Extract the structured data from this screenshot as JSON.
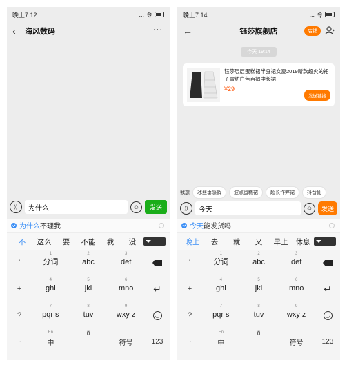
{
  "left": {
    "status": {
      "time": "晚上7:12",
      "signal": "...",
      "wifi": "令"
    },
    "header": {
      "title": "海风数码",
      "more": "···"
    },
    "input": {
      "text": "为什么",
      "send": "发送"
    },
    "prediction": {
      "highlight": "为什么",
      "rest": "不理我"
    },
    "candidates": [
      "不",
      "这么",
      "要",
      "不能",
      "我",
      "没"
    ],
    "keyboard": {
      "left_col": [
        "'",
        "+",
        "?",
        "!"
      ],
      "keys": [
        {
          "num": "1",
          "label": "分词"
        },
        {
          "num": "2",
          "label": "abc"
        },
        {
          "num": "3",
          "label": "def"
        },
        {
          "num": "4",
          "label": "ghi"
        },
        {
          "num": "5",
          "label": "jkl"
        },
        {
          "num": "6",
          "label": "mno"
        },
        {
          "num": "7",
          "label": "pqr s"
        },
        {
          "num": "8",
          "label": "tuv"
        },
        {
          "num": "9",
          "label": "wxy z"
        }
      ],
      "bottom": {
        "tilde": "~",
        "lang_small": "En",
        "lang": "中",
        "space_num": "0",
        "symbols": "符号",
        "num_mode": "123"
      }
    }
  },
  "right": {
    "status": {
      "time": "晚上7:14",
      "signal": "...",
      "wifi": "令"
    },
    "header": {
      "title": "钰莎旗舰店",
      "follow": "店铺"
    },
    "timestamp": "今天 19:14",
    "product": {
      "title": "钰莎层层蛋糕裙半身裙女夏2019新款超火的裙子雪纺白色百褶中长裙",
      "price": "¥29",
      "send_label": "发送链接"
    },
    "suggest_label": "我想",
    "suggest_chips": [
      "冰丝垂感裤",
      "波点蛋糕裙",
      "超长作弊裙",
      "抖音仙"
    ],
    "input": {
      "text": "今天",
      "send": "发送"
    },
    "prediction": {
      "highlight": "今天",
      "rest": "能发货吗"
    },
    "candidates": [
      "晚上",
      "去",
      "就",
      "又",
      "早上",
      "休息"
    ],
    "keyboard": {
      "left_col": [
        "'",
        "+",
        "?",
        "!"
      ],
      "keys": [
        {
          "num": "1",
          "label": "分词"
        },
        {
          "num": "2",
          "label": "abc"
        },
        {
          "num": "3",
          "label": "def"
        },
        {
          "num": "4",
          "label": "ghi"
        },
        {
          "num": "5",
          "label": "jkl"
        },
        {
          "num": "6",
          "label": "mno"
        },
        {
          "num": "7",
          "label": "pqr s"
        },
        {
          "num": "8",
          "label": "tuv"
        },
        {
          "num": "9",
          "label": "wxy z"
        }
      ],
      "bottom": {
        "tilde": "~",
        "lang_small": "En",
        "lang": "中",
        "space_num": "0",
        "symbols": "符号",
        "num_mode": "123"
      }
    }
  },
  "colors": {
    "send_green": "#1aad19",
    "accent_orange": "#ff7a00",
    "prediction_blue": "#3a8ef6"
  }
}
